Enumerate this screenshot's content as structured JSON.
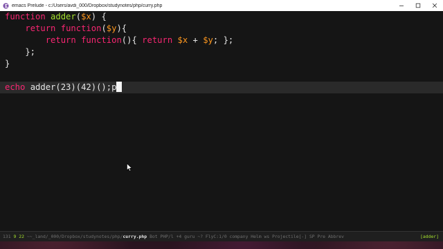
{
  "window": {
    "title": "emacs Prelude - c:/Users/avdi_000/Dropbox/studynotes/php/curry.php",
    "app_icon": "emacs-icon",
    "minimize_icon": "minimize-icon",
    "maximize_icon": "maximize-icon",
    "close_icon": "close-icon"
  },
  "editor": {
    "lines": [
      [
        {
          "t": "function",
          "c": "kw"
        },
        {
          "t": " ",
          "c": ""
        },
        {
          "t": "adder",
          "c": "fn"
        },
        {
          "t": "(",
          "c": ""
        },
        {
          "t": "$x",
          "c": "var"
        },
        {
          "t": ") {",
          "c": ""
        }
      ],
      [
        {
          "t": "    ",
          "c": ""
        },
        {
          "t": "return",
          "c": "kw"
        },
        {
          "t": " ",
          "c": ""
        },
        {
          "t": "function",
          "c": "kw"
        },
        {
          "t": "(",
          "c": ""
        },
        {
          "t": "$y",
          "c": "var"
        },
        {
          "t": "){",
          "c": ""
        }
      ],
      [
        {
          "t": "        ",
          "c": ""
        },
        {
          "t": "return",
          "c": "kw"
        },
        {
          "t": " ",
          "c": ""
        },
        {
          "t": "function",
          "c": "kw"
        },
        {
          "t": "(){ ",
          "c": ""
        },
        {
          "t": "return",
          "c": "kw"
        },
        {
          "t": " ",
          "c": ""
        },
        {
          "t": "$x",
          "c": "var"
        },
        {
          "t": " + ",
          "c": ""
        },
        {
          "t": "$y",
          "c": "var"
        },
        {
          "t": "; };",
          "c": ""
        }
      ],
      [
        {
          "t": "    };",
          "c": ""
        }
      ],
      [
        {
          "t": "}",
          "c": ""
        }
      ],
      [],
      [
        {
          "t": "echo",
          "c": "echo-kw"
        },
        {
          "t": " adder(23)(42)();p",
          "c": ""
        }
      ]
    ],
    "current_line_index": 6
  },
  "modeline": {
    "position": "131",
    "segment_line": "9 22",
    "path_prefix": "~~_land/_000/Dropbox/studynotes/php/",
    "filename": "curry.php",
    "info": "Bot PHP/l +4 guru ~? FlyC:1/0 company Helm ws Projectile[-] SP Pre Abbrev",
    "right_status": "[adder]"
  }
}
